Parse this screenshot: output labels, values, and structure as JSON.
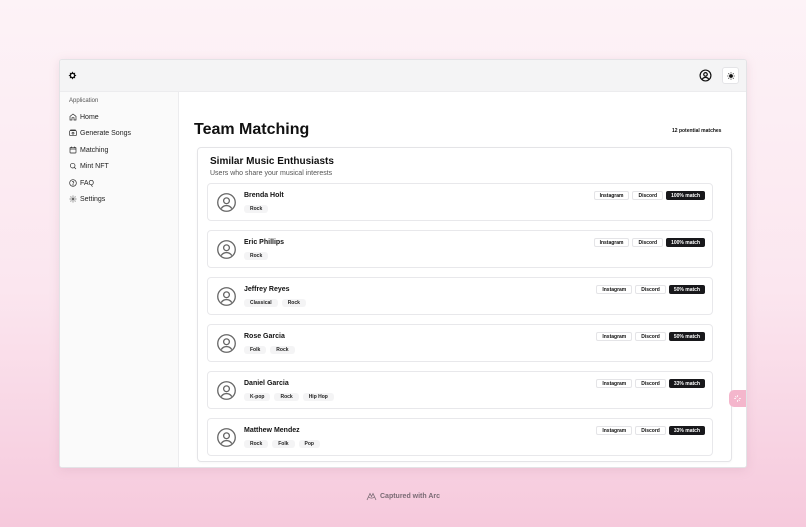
{
  "sidebar": {
    "group_label": "Application",
    "items": [
      {
        "label": "Home",
        "icon": "home-icon"
      },
      {
        "label": "Generate Songs",
        "icon": "album-icon"
      },
      {
        "label": "Matching",
        "icon": "calendar-icon"
      },
      {
        "label": "Mint NFT",
        "icon": "search-icon"
      },
      {
        "label": "FAQ",
        "icon": "help-circle-icon"
      },
      {
        "label": "Settings",
        "icon": "gear-icon"
      }
    ]
  },
  "main": {
    "title": "Team Matching",
    "match_count": "12 potential matches",
    "card": {
      "title": "Similar Music Enthusiasts",
      "description": "Users who share your musical interests",
      "instagram_label": "Instagram",
      "discord_label": "Discord",
      "matches": [
        {
          "name": "Brenda Holt",
          "genres": [
            "Rock"
          ],
          "match": "100% match"
        },
        {
          "name": "Eric Phillips",
          "genres": [
            "Rock"
          ],
          "match": "100% match"
        },
        {
          "name": "Jeffrey Reyes",
          "genres": [
            "Classical",
            "Rock"
          ],
          "match": "50% match"
        },
        {
          "name": "Rose Garcia",
          "genres": [
            "Folk",
            "Rock"
          ],
          "match": "50% match"
        },
        {
          "name": "Daniel Garcia",
          "genres": [
            "K-pop",
            "Rock",
            "Hip Hop"
          ],
          "match": "33% match"
        },
        {
          "name": "Matthew Mendez",
          "genres": [
            "Rock",
            "Folk",
            "Pop"
          ],
          "match": "33% match"
        }
      ]
    }
  },
  "footer": {
    "captured_label": "Captured with Arc"
  },
  "colors": {
    "accent": "#18181b",
    "page_pink": "#f6c9dc"
  }
}
